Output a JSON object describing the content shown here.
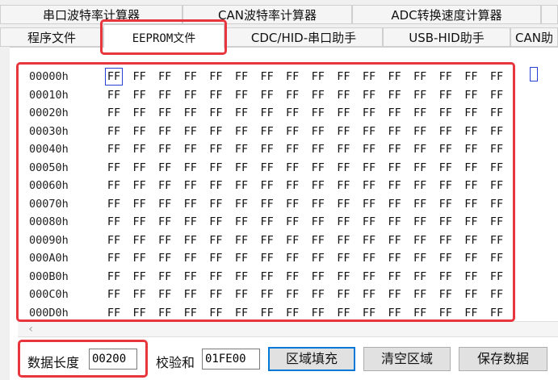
{
  "tabs_row1": [
    {
      "label": "串口波特率计算器"
    },
    {
      "label": "CAN波特率计算器"
    },
    {
      "label": "ADC转换速度计算器"
    }
  ],
  "tabs_row2": [
    {
      "label": "程序文件"
    },
    {
      "label": "EEPROM文件",
      "active": true
    },
    {
      "label": "CDC/HID-串口助手"
    },
    {
      "label": "USB-HID助手"
    },
    {
      "label": "CAN助"
    }
  ],
  "hex": {
    "addresses": [
      "00000h",
      "00010h",
      "00020h",
      "00030h",
      "00040h",
      "00050h",
      "00060h",
      "00070h",
      "00080h",
      "00090h",
      "000A0h",
      "000B0h",
      "000C0h",
      "000D0h"
    ],
    "fill_value": "FF",
    "columns": 16,
    "selected_row": 0,
    "selected_col": 0
  },
  "bottom": {
    "length_label": "数据长度",
    "length_value": "00200",
    "checksum_label": "校验和",
    "checksum_value": "01FE00",
    "fill_button": "区域填充",
    "clear_button": "清空区域",
    "save_button": "保存数据"
  },
  "colors": {
    "highlight": "#e8363e",
    "selection": "#2a3fd6"
  },
  "icons": {
    "scroll_left": "chevron-left-icon"
  }
}
